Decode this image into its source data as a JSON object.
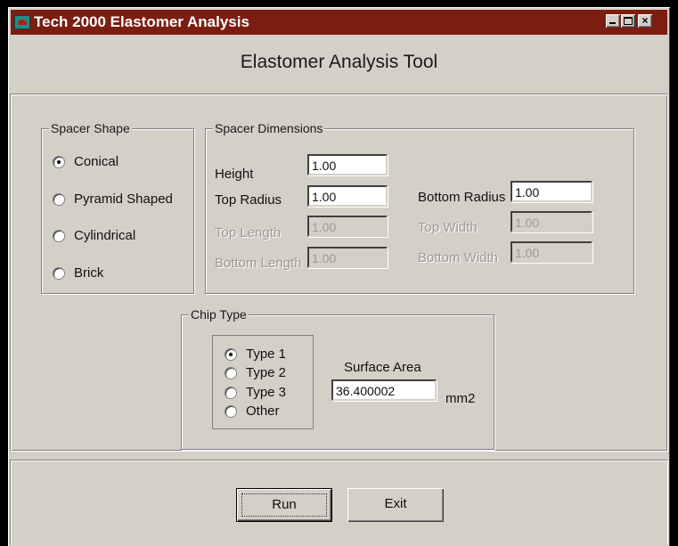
{
  "window": {
    "title": "Tech 2000 Elastomer Analysis",
    "controls": {
      "minimize": "_",
      "maximize": "□",
      "close": "×"
    }
  },
  "header": {
    "title": "Elastomer Analysis Tool"
  },
  "spacer_shape": {
    "label": "Spacer Shape",
    "options": [
      {
        "label": "Conical",
        "selected": true
      },
      {
        "label": "Pyramid Shaped",
        "selected": false
      },
      {
        "label": "Cylindrical",
        "selected": false
      },
      {
        "label": "Brick",
        "selected": false
      }
    ]
  },
  "spacer_dimensions": {
    "label": "Spacer Dimensions",
    "height": {
      "label": "Height",
      "value": "1.00",
      "enabled": true
    },
    "top_radius": {
      "label": "Top Radius",
      "value": "1.00",
      "enabled": true
    },
    "top_length": {
      "label": "Top Length",
      "value": "1.00",
      "enabled": false
    },
    "bottom_length": {
      "label": "Bottom Length",
      "value": "1.00",
      "enabled": false
    },
    "bottom_radius": {
      "label": "Bottom Radius",
      "value": "1.00",
      "enabled": true
    },
    "top_width": {
      "label": "Top Width",
      "value": "1.00",
      "enabled": false
    },
    "bottom_width": {
      "label": "Bottom Width",
      "value": "1.00",
      "enabled": false
    }
  },
  "chip_type": {
    "label": "Chip Type",
    "options": [
      {
        "label": "Type 1",
        "selected": true
      },
      {
        "label": "Type 2",
        "selected": false
      },
      {
        "label": "Type 3",
        "selected": false
      },
      {
        "label": "Other",
        "selected": false
      }
    ],
    "surface_area": {
      "label": "Surface Area",
      "value": "36.400002",
      "unit": "mm2"
    }
  },
  "buttons": {
    "run": "Run",
    "exit": "Exit"
  },
  "colors": {
    "title_bar": "#7c1d12",
    "window_face": "#d4d0c8",
    "disabled_text": "#9c9a94"
  }
}
